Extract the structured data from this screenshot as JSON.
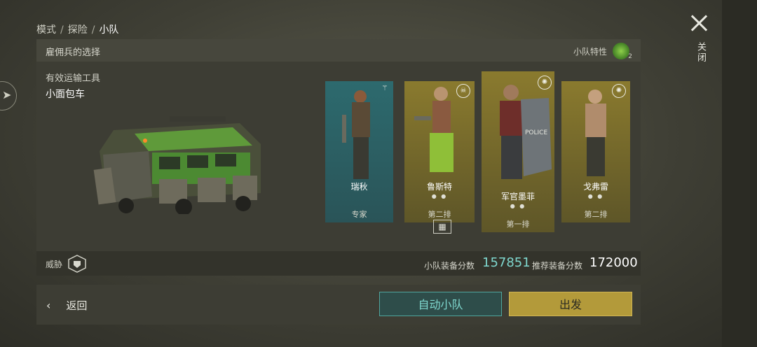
{
  "breadcrumb": {
    "item1": "模式",
    "sep": "/",
    "item2": "探险",
    "current": "小队"
  },
  "close": {
    "label": "关闭"
  },
  "panel": {
    "title": "雇佣兵的选择",
    "traits_label": "小队特性",
    "traits_count": "2",
    "vehicle_label": "有效运输工具",
    "vehicle_name": "小面包车"
  },
  "squad": [
    {
      "name": "瑞秋",
      "role": "专家",
      "dots": "",
      "accent": "#2d6a6e"
    },
    {
      "name": "鲁斯特",
      "role": "第二排",
      "dots": "● ●",
      "accent": "#8a7a2e"
    },
    {
      "name": "军官墨菲",
      "role": "第一排",
      "dots": "● ●",
      "accent": "#8a7a2e"
    },
    {
      "name": "戈弗雷",
      "role": "第二排",
      "dots": "● ●",
      "accent": "#8a7a2e"
    }
  ],
  "stats": {
    "threat_label": "威胁",
    "squad_score_label": "小队装备分数",
    "squad_score": "157851",
    "recommended_label": "推荐装备分数",
    "recommended_score": "172000"
  },
  "actions": {
    "back": "返回",
    "auto_squad": "自动小队",
    "depart": "出发"
  },
  "colors": {
    "teal": "#7fd8cf",
    "gold": "#b39a3a"
  },
  "icons": [
    "close-icon",
    "chevron-left-icon",
    "skull-icon",
    "shield-icon",
    "squad-trait-icon"
  ]
}
